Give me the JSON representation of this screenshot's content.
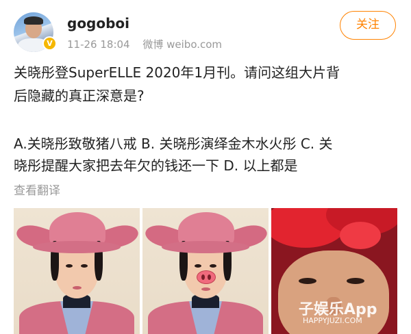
{
  "post": {
    "username": "gogoboi",
    "time": "11-26 18:04",
    "source": "微博 weibo.com",
    "follow_label": "关注",
    "text_lines": [
      "关晓彤登SuperELLE 2020年1月刊。请问这组大片背",
      "后隐藏的真正深意是?",
      "A.关晓彤致敬猪八戒  B. 关晓彤演绎金木水火彤  C. 关",
      "晓彤提醒大家把去年欠的钱还一下  D. 以上都是"
    ],
    "translate_label": "查看翻译"
  },
  "watermark": {
    "logo": "子娱乐App",
    "url": "HAPPYJUZI.COM"
  },
  "colors": {
    "accent": "#ff8200",
    "meta_gray": "#999999",
    "verified_badge": "#f5b700"
  },
  "icons": {
    "verified": "yellow-v-badge"
  }
}
